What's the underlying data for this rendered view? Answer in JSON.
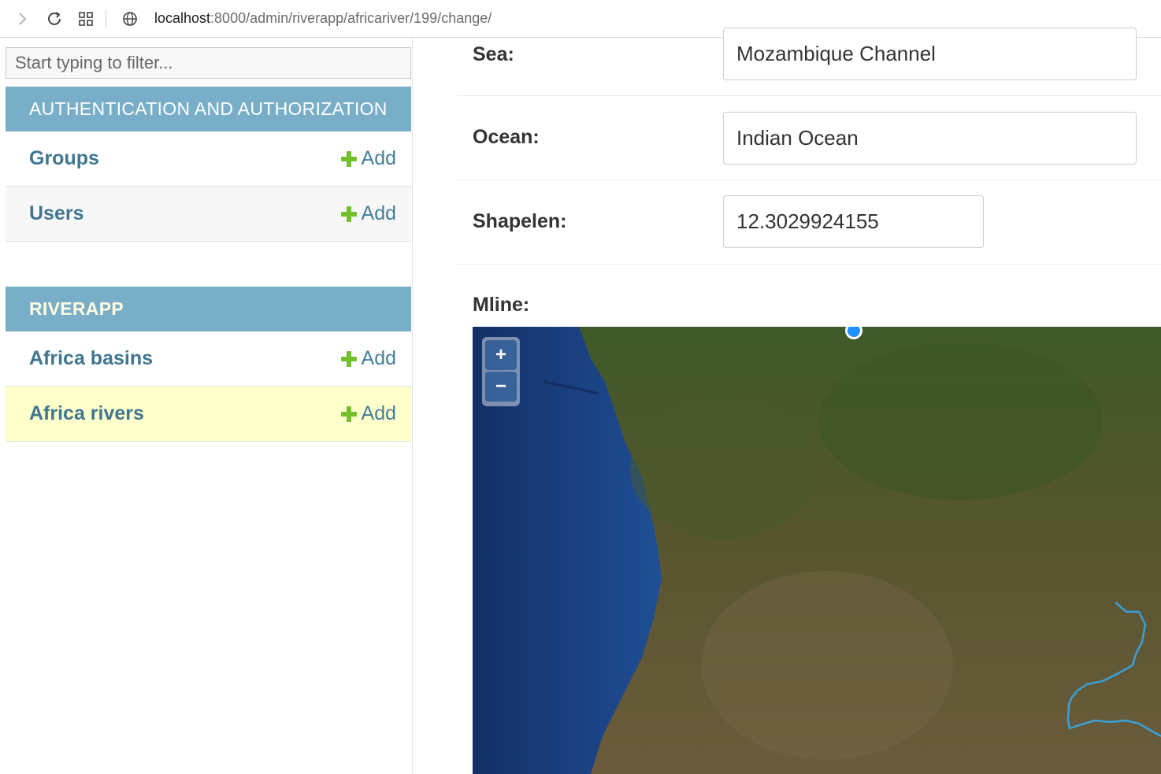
{
  "browser": {
    "url_host": "localhost",
    "url_path": ":8000/admin/riverapp/africariver/199/change/"
  },
  "sidebar": {
    "filter_placeholder": "Start typing to filter...",
    "modules": [
      {
        "caption": "AUTHENTICATION AND AUTHORIZATION",
        "models": [
          {
            "name": "Groups",
            "add_label": "Add"
          },
          {
            "name": "Users",
            "add_label": "Add"
          }
        ]
      },
      {
        "caption": "RIVERAPP",
        "models": [
          {
            "name": "Africa basins",
            "add_label": "Add"
          },
          {
            "name": "Africa rivers",
            "add_label": "Add"
          }
        ]
      }
    ]
  },
  "form": {
    "sea": {
      "label": "Sea:",
      "value": "Mozambique Channel"
    },
    "ocean": {
      "label": "Ocean:",
      "value": "Indian Ocean"
    },
    "shapelen": {
      "label": "Shapelen:",
      "value": "12.3029924155"
    },
    "mline": {
      "label": "Mline:"
    }
  },
  "map": {
    "zoom_in": "+",
    "zoom_out": "−",
    "colors": {
      "ocean": "#1d3f78",
      "land": "#5d5a3a",
      "river": "#3aa0d8",
      "vertex": "#1e90ff"
    }
  }
}
